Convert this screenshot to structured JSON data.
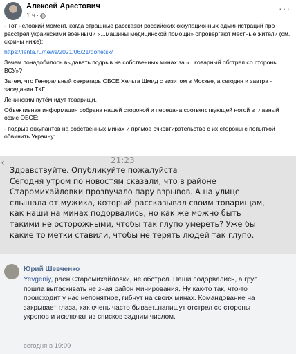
{
  "header": {
    "author": "Алексей Арестович",
    "time": "1 ч",
    "separator": "·",
    "more": "···"
  },
  "post": {
    "p1": "- Тот неловкий момент, когда страшные рассказки российских оккупационных администраций про расстрел украинскими военными «...машины медицинской помощи» опровергают местные жители (см. скрины ниже):",
    "link": "https://lenta.ru/news/2021/06/21/donetsk/",
    "p2": "Зачем понадобилось выдавать подрыв на собственных минах за «...коварный обстрел со стороны ВСУ»?",
    "p3": "Затем, что Генеральный секретарь ОБСЕ Хельга Шмид с визитом в Москве, а сегодня и завтра - заседания ТКГ.",
    "p4": "Ленинским путём идут товарищи.",
    "p5": "Объективная информация собрана нашей стороной и передана соответствующей нотой в главный офис ОБСЕ:",
    "p6": "- подрыв оккупантов на собственных минах и прямое очковтирательство с их стороны с попыткой обвинить Украину:"
  },
  "screenshot1": {
    "time": "21:23",
    "lines": [
      "Здравствуйте. Опубликуйте пожалуйста",
      "Сегодня утром по новостям сказали, что в районе",
      "Старомихайловки прозвучало пару взрывов. А на улице",
      "слышала от мужика, который рассказывал своим товарищам,",
      "как наши на минах подорвались, но как же можно быть",
      "такими не осторожными, чтобы так глупо умереть? Уже бы",
      "какие то метки ставили, чтобы не терять людей так глупо."
    ]
  },
  "screenshot2": {
    "author": "Юрий Шевченко",
    "mention": "Yevgeniy",
    "lines": [
      ", раён Старомихайловки, не обстрел. Наши подорвались, а груп",
      "пошла вытаскивать не зная район минирования. Ну как-то так, что-то",
      "происходит у нас непонятное, гибнут на своих минах. Командование на",
      "закрывает глаза, как очень часто бывает..напишут отстрел со стороны",
      "укропов и исключат из списков задним числом."
    ],
    "time": "сегодня в 19:09"
  }
}
